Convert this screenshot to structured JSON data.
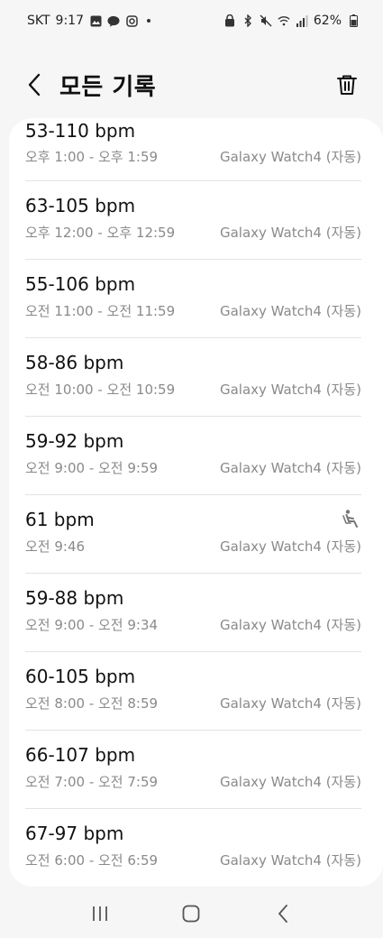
{
  "status_bar": {
    "carrier": "SKT",
    "time": "9:17",
    "battery": "62%",
    "icons": [
      "gallery-icon",
      "kakaotalk-icon",
      "instagram-icon",
      "dot-icon",
      "lock-icon",
      "bluetooth-icon",
      "mute-icon",
      "wifi-icon",
      "signal-icon",
      "battery-icon"
    ]
  },
  "header": {
    "title": "모든 기록",
    "back_icon": "chevron-left-icon",
    "delete_icon": "trash-icon"
  },
  "records": [
    {
      "bpm": "53-110 bpm",
      "time": "오후 1:00 - 오후 1:59",
      "source": "Galaxy Watch4 (자동)"
    },
    {
      "bpm": "63-105 bpm",
      "time": "오후 12:00 - 오후 12:59",
      "source": "Galaxy Watch4 (자동)"
    },
    {
      "bpm": "55-106 bpm",
      "time": "오전 11:00 - 오전 11:59",
      "source": "Galaxy Watch4 (자동)"
    },
    {
      "bpm": "58-86 bpm",
      "time": "오전 10:00 - 오전 10:59",
      "source": "Galaxy Watch4 (자동)"
    },
    {
      "bpm": "59-92 bpm",
      "time": "오전 9:00 - 오전 9:59",
      "source": "Galaxy Watch4 (자동)"
    },
    {
      "bpm": "61 bpm",
      "time": "오전 9:46",
      "source": "Galaxy Watch4 (자동)",
      "activity_icon": "resting-person-icon"
    },
    {
      "bpm": "59-88 bpm",
      "time": "오전 9:00 - 오전 9:34",
      "source": "Galaxy Watch4 (자동)"
    },
    {
      "bpm": "60-105 bpm",
      "time": "오전 8:00 - 오전 8:59",
      "source": "Galaxy Watch4 (자동)"
    },
    {
      "bpm": "66-107 bpm",
      "time": "오전 7:00 - 오전 7:59",
      "source": "Galaxy Watch4 (자동)"
    },
    {
      "bpm": "67-97 bpm",
      "time": "오전 6:00 - 오전 6:59",
      "source": "Galaxy Watch4 (자동)"
    }
  ],
  "nav": {
    "recents_icon": "recents-icon",
    "home_icon": "home-icon",
    "back_icon": "back-icon"
  },
  "colors": {
    "background": "#f6f6f6",
    "card": "#ffffff",
    "primary_text": "#111111",
    "secondary_text": "#8a8a8a",
    "divider": "#e3e3e3"
  }
}
